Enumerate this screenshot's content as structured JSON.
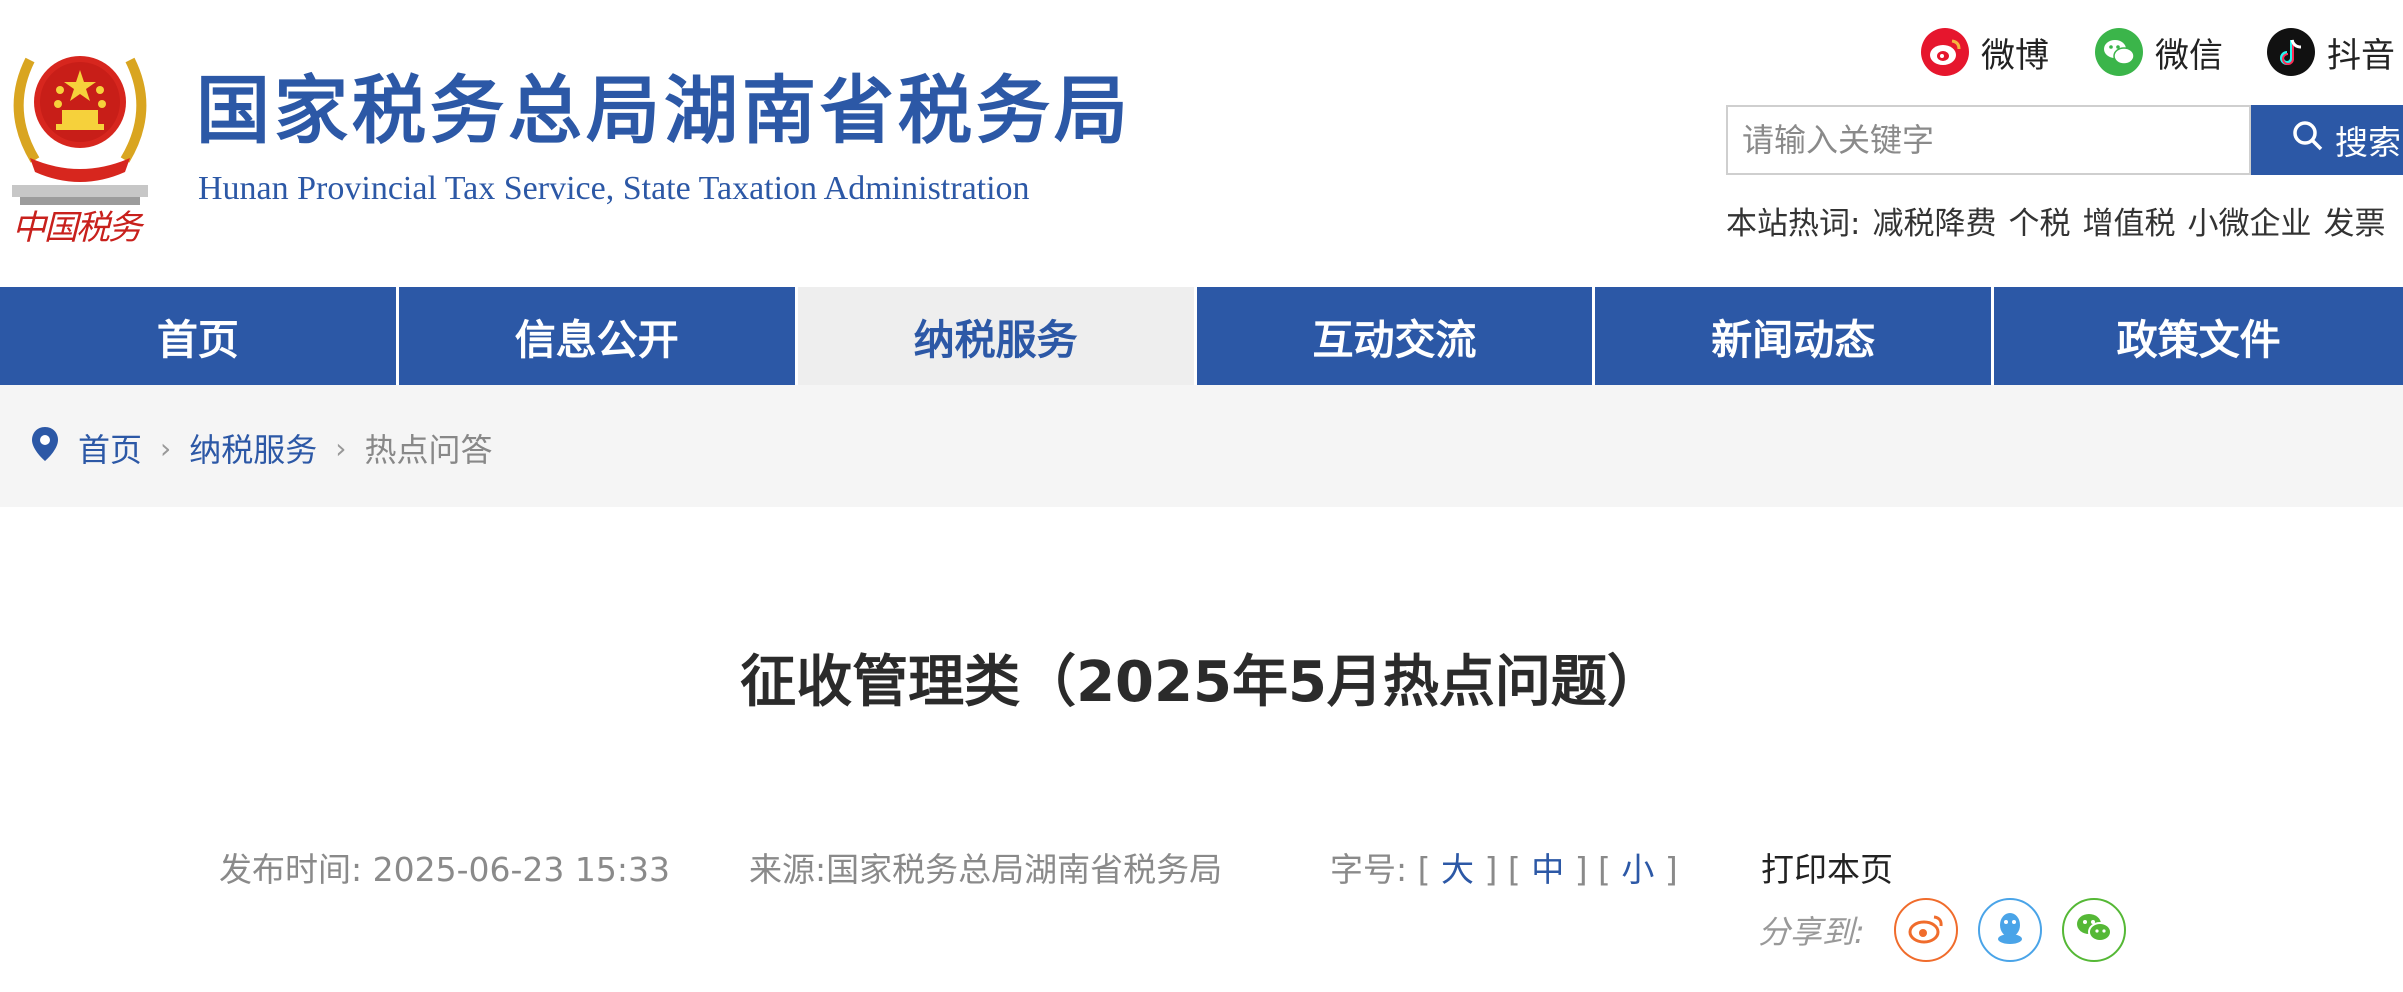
{
  "header": {
    "title": "国家税务总局湖南省税务局",
    "subtitle": "Hunan Provincial  Tax Service,  State Taxation Administration",
    "emblem_text": "中国税务",
    "social": [
      {
        "label": "微博",
        "icon": "weibo-icon",
        "color": "#e6162d"
      },
      {
        "label": "微信",
        "icon": "wechat-icon",
        "color": "#3bb54a"
      },
      {
        "label": "抖音",
        "icon": "douyin-icon",
        "color": "#111111"
      }
    ],
    "search": {
      "placeholder": "请输入关键字",
      "button_label": "搜索"
    },
    "hot": {
      "label": "本站热词:",
      "words": [
        "减税降费",
        "个税",
        "增值税",
        "小微企业",
        "发票"
      ]
    }
  },
  "nav": {
    "items": [
      {
        "label": "首页",
        "active": false
      },
      {
        "label": "信息公开",
        "active": false
      },
      {
        "label": "纳税服务",
        "active": true
      },
      {
        "label": "互动交流",
        "active": false
      },
      {
        "label": "新闻动态",
        "active": false
      },
      {
        "label": "政策文件",
        "active": false
      }
    ]
  },
  "breadcrumb": {
    "items": [
      "首页",
      "纳税服务"
    ],
    "current": "热点问答"
  },
  "article": {
    "title": "征收管理类（2025年5月热点问题）",
    "publish_label": "发布时间:",
    "publish_time": "2025-06-23 15:33",
    "source_label": "来源:",
    "source": "国家税务总局湖南省税务局",
    "font_size_label": "字号:",
    "font_sizes": [
      "大",
      "中",
      "小"
    ],
    "print_label": "打印本页",
    "share_label": "分享到:"
  },
  "colors": {
    "brand_blue": "#2c58a6",
    "weibo_share": "#f06c2c",
    "qq_share": "#4aa4e8",
    "wechat_share": "#55b836"
  }
}
